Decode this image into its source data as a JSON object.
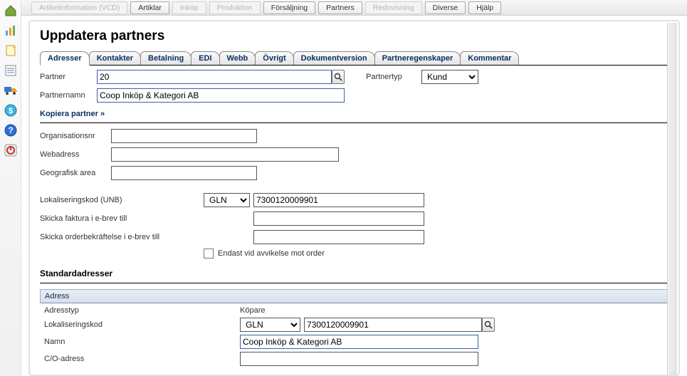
{
  "menubar": {
    "items": [
      {
        "label": "Artikelinformation (VCD)",
        "enabled": false
      },
      {
        "label": "Artiklar",
        "enabled": true
      },
      {
        "label": "Inköp",
        "enabled": false
      },
      {
        "label": "Produktion",
        "enabled": false
      },
      {
        "label": "Försäljning",
        "enabled": true
      },
      {
        "label": "Partners",
        "enabled": true
      },
      {
        "label": "Redovisning",
        "enabled": false
      },
      {
        "label": "Diverse",
        "enabled": true
      },
      {
        "label": "Hjälp",
        "enabled": true
      }
    ]
  },
  "rail_icons": [
    {
      "name": "home-icon",
      "color": "#7aa93a"
    },
    {
      "name": "chart-icon",
      "color": "#f08a1f"
    },
    {
      "name": "note-icon",
      "color": "#f0d040"
    },
    {
      "name": "list-icon",
      "color": "#6a84b0"
    },
    {
      "name": "truck-icon",
      "color": "#f0a020"
    },
    {
      "name": "coin-icon",
      "color": "#3bb6e4"
    },
    {
      "name": "help-icon",
      "color": "#2a70d6"
    },
    {
      "name": "power-icon",
      "color": "#c83232"
    }
  ],
  "page": {
    "title": "Uppdatera partners",
    "tabs": [
      {
        "label": "Adresser",
        "active": true
      },
      {
        "label": "Kontakter",
        "active": false
      },
      {
        "label": "Betalning",
        "active": false
      },
      {
        "label": "EDI",
        "active": false
      },
      {
        "label": "Webb",
        "active": false
      },
      {
        "label": "Övrigt",
        "active": false
      },
      {
        "label": "Dokumentversion",
        "active": false
      },
      {
        "label": "Partneregenskaper",
        "active": false
      },
      {
        "label": "Kommentar",
        "active": false
      }
    ]
  },
  "form": {
    "partner_label": "Partner",
    "partner_value": "20",
    "partnertyp_label": "Partnertyp",
    "partnertyp_value": "Kund",
    "partnernamn_label": "Partnernamn",
    "partnernamn_value": "Coop Inköp & Kategori AB",
    "copy_link": "Kopiera partner »",
    "orgnr_label": "Organisationsnr",
    "orgnr_value": "",
    "webadress_label": "Webadress",
    "webadress_value": "",
    "geo_label": "Geografisk area",
    "geo_value": "",
    "lokkod_label": "Lokaliseringskod (UNB)",
    "lokkod_type": "GLN",
    "lokkod_value": "7300120009901",
    "inv_email_label": "Skicka faktura i e-brev till",
    "inv_email_value": "",
    "ord_email_label": "Skicka orderbekräftelse i e-brev till",
    "ord_email_value": "",
    "deviation_label": "Endast vid avvikelse mot order",
    "std_heading": "Standardadresser",
    "addr_group": "Adress",
    "addr_type_label": "Adresstyp",
    "addr_type_value": "Köpare",
    "addr_lok_label": "Lokaliseringskod",
    "addr_lok_type": "GLN",
    "addr_lok_value": "7300120009901",
    "addr_name_label": "Namn",
    "addr_name_value": "Coop Inköp & Kategori AB",
    "addr_co_label": "C/O-adress",
    "addr_co_value": ""
  }
}
